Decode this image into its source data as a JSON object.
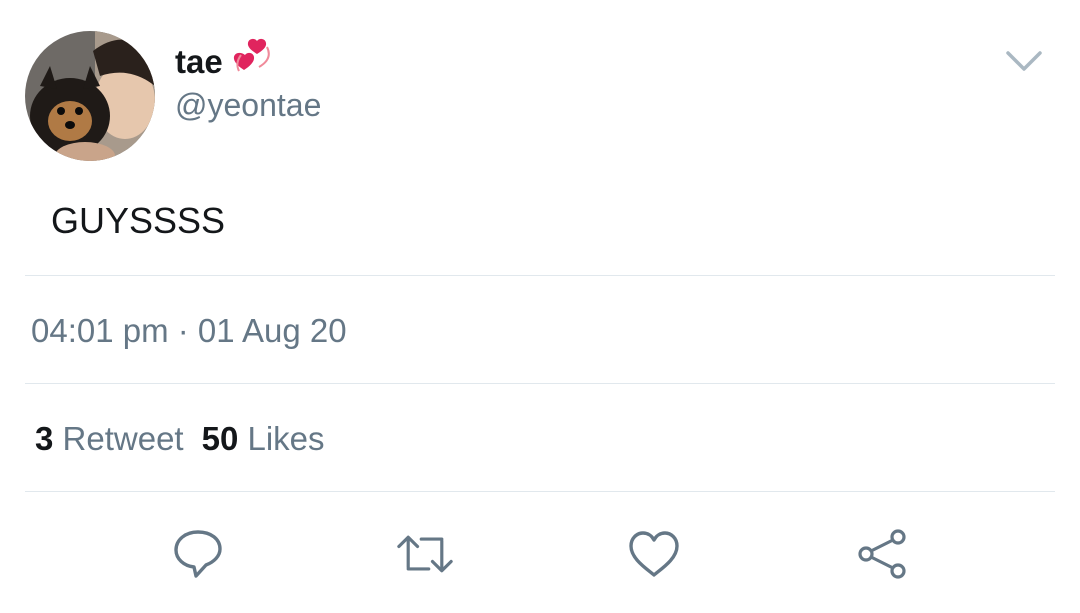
{
  "author": {
    "display_name": "tae",
    "name_emoji": "revolving-hearts-emoji",
    "handle": "@yeontae"
  },
  "tweet": {
    "text": "GUYSSSS",
    "timestamp": "04:01 pm · 01 Aug 20"
  },
  "stats": {
    "retweet_count": "3",
    "retweet_label": "Retweet",
    "like_count": "50",
    "like_label": "Likes"
  },
  "actions": [
    {
      "name": "reply",
      "icon": "speech-bubble-icon"
    },
    {
      "name": "retweet",
      "icon": "retweet-arrows-icon"
    },
    {
      "name": "like",
      "icon": "heart-icon"
    },
    {
      "name": "share",
      "icon": "share-nodes-icon"
    }
  ],
  "colors": {
    "text_primary": "#14171a",
    "text_secondary": "#657786",
    "divider": "#e1e8ed",
    "icon": "#657786",
    "heart_red": "#e0245e"
  }
}
